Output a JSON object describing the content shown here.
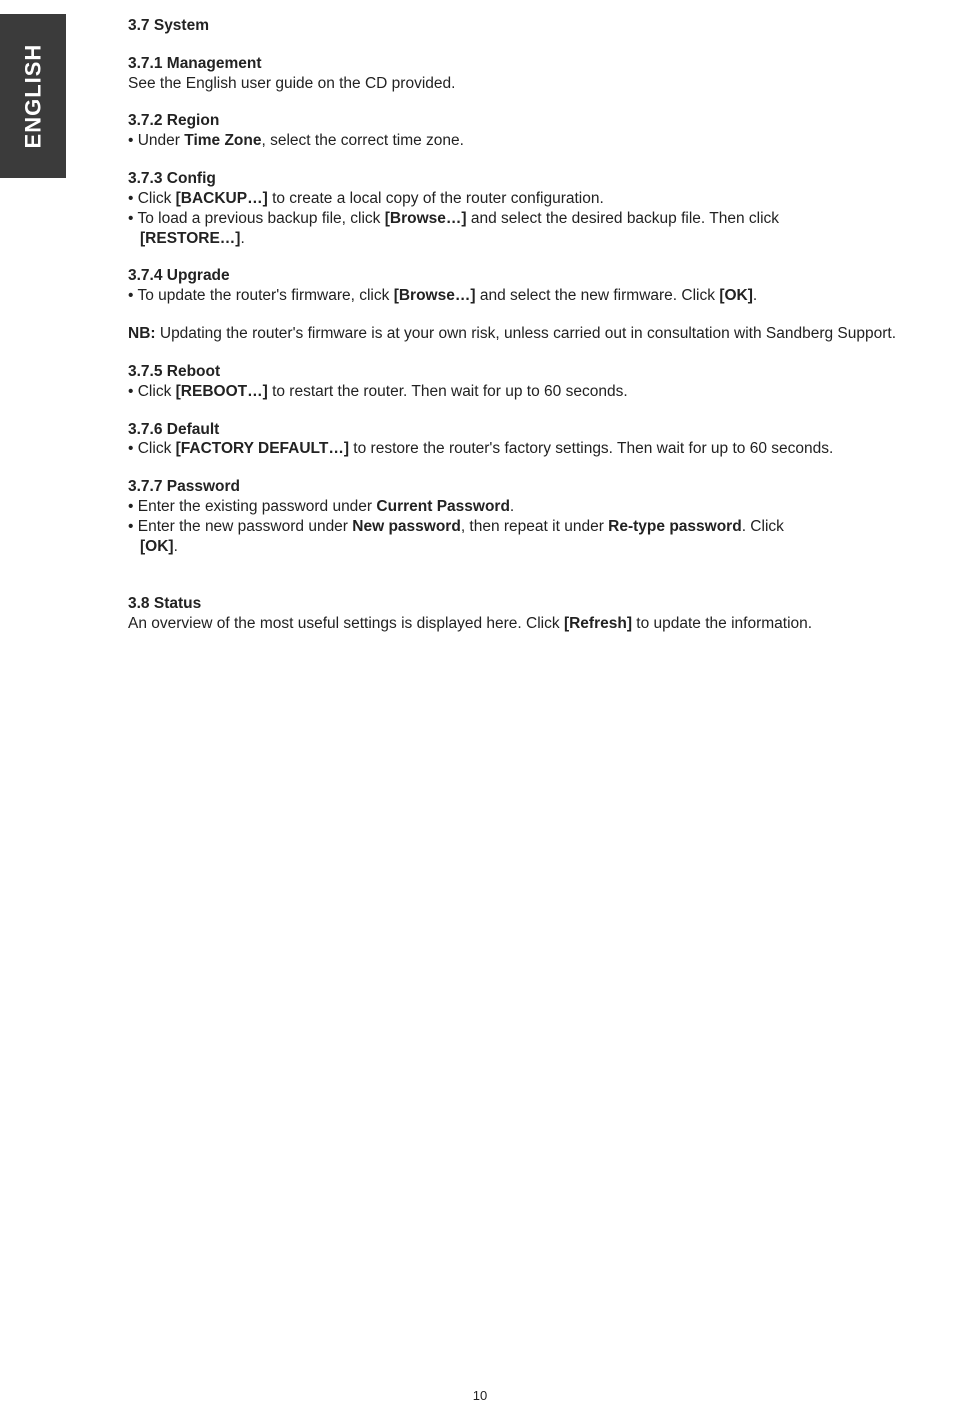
{
  "tab_label": "ENGLISH",
  "page_number": "10",
  "h37": "3.7 System",
  "s371": {
    "title": "3.7.1 Management",
    "body": "See the English user guide on the CD provided."
  },
  "s372": {
    "title": "3.7.2 Region",
    "bullet_prefix": "• Under ",
    "bold1": "Time Zone",
    "suffix": ", select the correct time zone."
  },
  "s373": {
    "title": "3.7.3 Config",
    "l1_pre": "• Click ",
    "l1_b": "[BACKUP…]",
    "l1_suf": " to create a local copy of the router configuration.",
    "l2_pre": "• To load a previous backup file, click ",
    "l2_b1": "[Browse…]",
    "l2_mid": " and select the desired backup file. Then click ",
    "l2_b2": "[RESTORE…]",
    "l2_suf": "."
  },
  "s374": {
    "title": "3.7.4 Upgrade",
    "l1_pre": "• To update the router's firmware, click ",
    "l1_b1": "[Browse…]",
    "l1_mid": " and select the new firmware. Click ",
    "l1_b2": "[OK]",
    "l1_suf": "."
  },
  "nb": {
    "label": "NB:",
    "body": " Updating the router's firmware is at your own risk, unless carried out in consultation with Sandberg Support."
  },
  "s375": {
    "title": "3.7.5 Reboot",
    "pre": "• Click ",
    "b": "[REBOOT…]",
    "suf": " to restart the router. Then wait for up to 60 seconds."
  },
  "s376": {
    "title": "3.7.6 Default",
    "pre": "• Click ",
    "b": "[FACTORY DEFAULT…]",
    "suf": " to restore the router's factory settings. Then wait for up to 60 seconds."
  },
  "s377": {
    "title": "3.7.7 Password",
    "l1_pre": "• Enter the existing password under ",
    "l1_b": "Current Password",
    "l1_suf": ".",
    "l2_pre": "• Enter the new password under ",
    "l2_b1": "New password",
    "l2_mid": ", then repeat it under ",
    "l2_b2": "Re-type password",
    "l2_mid2": ". Click ",
    "l2_b3": "[OK]",
    "l2_suf": "."
  },
  "s38": {
    "title": "3.8 Status",
    "pre": "An overview of the most useful settings is displayed here. Click ",
    "b": "[Refresh]",
    "suf": " to update the information."
  }
}
